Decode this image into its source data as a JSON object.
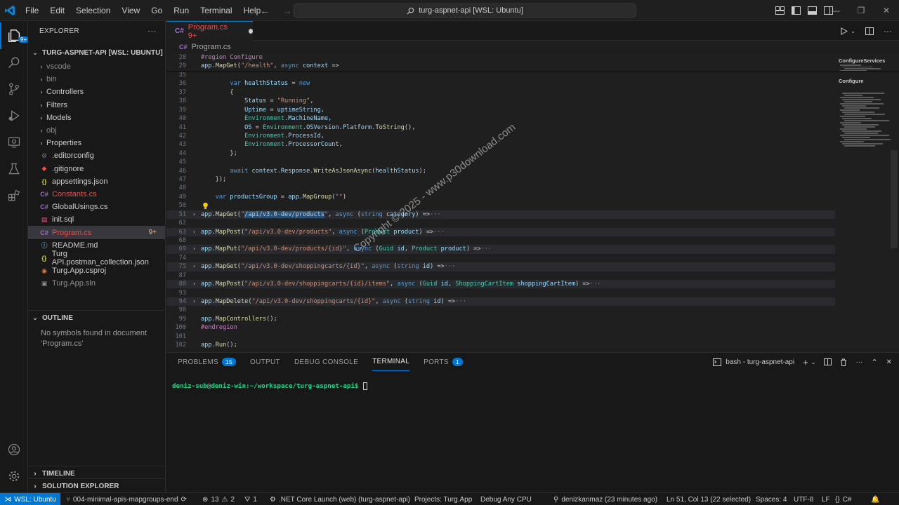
{
  "titlebar": {
    "menu": [
      "File",
      "Edit",
      "Selection",
      "View",
      "Go",
      "Run",
      "Terminal",
      "Help"
    ],
    "search_text": "turg-aspnet-api [WSL: Ubuntu]"
  },
  "sidebar": {
    "explorer_title": "EXPLORER",
    "more": "···",
    "root_label": "TURG-ASPNET-API [WSL: UBUNTU]",
    "items": [
      {
        "label": "vscode",
        "type": "folder",
        "state": "ignored"
      },
      {
        "label": "bin",
        "type": "folder",
        "state": "ignored"
      },
      {
        "label": "Controllers",
        "type": "folder",
        "state": "normal"
      },
      {
        "label": "Filters",
        "type": "folder",
        "state": "normal"
      },
      {
        "label": "Models",
        "type": "folder",
        "state": "normal"
      },
      {
        "label": "obj",
        "type": "folder",
        "state": "ignored"
      },
      {
        "label": "Properties",
        "type": "folder",
        "state": "normal"
      },
      {
        "label": ".editorconfig",
        "type": "file",
        "state": "normal",
        "icon": "gear"
      },
      {
        "label": ".gitignore",
        "type": "file",
        "state": "normal",
        "icon": "git"
      },
      {
        "label": "appsettings.json",
        "type": "file",
        "state": "normal",
        "icon": "json"
      },
      {
        "label": "Constants.cs",
        "type": "file",
        "state": "error",
        "icon": "cs"
      },
      {
        "label": "GlobalUsings.cs",
        "type": "file",
        "state": "normal",
        "icon": "cs"
      },
      {
        "label": "init.sql",
        "type": "file",
        "state": "normal",
        "icon": "db"
      },
      {
        "label": "Program.cs",
        "type": "file",
        "state": "error",
        "icon": "cs",
        "badge": "9+"
      },
      {
        "label": "README.md",
        "type": "file",
        "state": "normal",
        "icon": "info"
      },
      {
        "label": "Turg API.postman_collection.json",
        "type": "file",
        "state": "normal",
        "icon": "json"
      },
      {
        "label": "Turg.App.csproj",
        "type": "file",
        "state": "normal",
        "icon": "rss"
      },
      {
        "label": "Turg.App.sln",
        "type": "file",
        "state": "ignored",
        "icon": "sln"
      }
    ],
    "outline_label": "OUTLINE",
    "outline_empty": "No symbols found in document 'Program.cs'",
    "timeline_label": "TIMELINE",
    "solution_label": "SOLUTION EXPLORER"
  },
  "editor": {
    "tab_label": "Program.cs",
    "tab_badge": "9+",
    "breadcrumb": "Program.cs",
    "sticky": [
      {
        "n": "28",
        "tokens": [
          [
            "pp",
            "#region Configure"
          ]
        ]
      },
      {
        "n": "29",
        "tokens": [
          [
            "id",
            "app"
          ],
          [
            "",
            "."
          ],
          [
            "fn",
            "MapGet"
          ],
          [
            "",
            "("
          ],
          [
            "str",
            "\"/health\""
          ],
          [
            "",
            ", "
          ],
          [
            "kw",
            "async"
          ],
          [
            "",
            " "
          ],
          [
            "id",
            "context"
          ],
          [
            "",
            " =>"
          ]
        ]
      }
    ],
    "lines": [
      {
        "n": "35",
        "tokens": []
      },
      {
        "n": "36",
        "tokens": [
          [
            "",
            "        "
          ],
          [
            "kw",
            "var"
          ],
          [
            "",
            " "
          ],
          [
            "id",
            "healthStatus"
          ],
          [
            "",
            " = "
          ],
          [
            "kw",
            "new"
          ]
        ]
      },
      {
        "n": "37",
        "tokens": [
          [
            "",
            "        {"
          ]
        ]
      },
      {
        "n": "38",
        "tokens": [
          [
            "",
            "            "
          ],
          [
            "id",
            "Status"
          ],
          [
            "",
            " = "
          ],
          [
            "str",
            "\"Running\""
          ],
          [
            "",
            ","
          ]
        ]
      },
      {
        "n": "39",
        "tokens": [
          [
            "",
            "            "
          ],
          [
            "id",
            "Uptime"
          ],
          [
            "",
            " = "
          ],
          [
            "id",
            "uptimeString"
          ],
          [
            "",
            ","
          ]
        ]
      },
      {
        "n": "40",
        "tokens": [
          [
            "",
            "            "
          ],
          [
            "ty",
            "Environment"
          ],
          [
            "",
            "."
          ],
          [
            "id",
            "MachineName"
          ],
          [
            "",
            ","
          ]
        ]
      },
      {
        "n": "41",
        "tokens": [
          [
            "",
            "            "
          ],
          [
            "id",
            "OS"
          ],
          [
            "",
            " = "
          ],
          [
            "ty",
            "Environment"
          ],
          [
            "",
            "."
          ],
          [
            "id",
            "OSVersion"
          ],
          [
            "",
            "."
          ],
          [
            "id",
            "Platform"
          ],
          [
            "",
            "."
          ],
          [
            "fn",
            "ToString"
          ],
          [
            "",
            "(),"
          ]
        ]
      },
      {
        "n": "42",
        "tokens": [
          [
            "",
            "            "
          ],
          [
            "ty",
            "Environment"
          ],
          [
            "",
            "."
          ],
          [
            "id",
            "ProcessId"
          ],
          [
            "",
            ","
          ]
        ]
      },
      {
        "n": "43",
        "tokens": [
          [
            "",
            "            "
          ],
          [
            "ty",
            "Environment"
          ],
          [
            "",
            "."
          ],
          [
            "id",
            "ProcessorCount"
          ],
          [
            "",
            ","
          ]
        ]
      },
      {
        "n": "44",
        "tokens": [
          [
            "",
            "        };"
          ]
        ]
      },
      {
        "n": "45",
        "tokens": []
      },
      {
        "n": "46",
        "tokens": [
          [
            "",
            "        "
          ],
          [
            "kw",
            "await"
          ],
          [
            "",
            " "
          ],
          [
            "id",
            "context"
          ],
          [
            "",
            "."
          ],
          [
            "id",
            "Response"
          ],
          [
            "",
            "."
          ],
          [
            "fn",
            "WriteAsJsonAsync"
          ],
          [
            "",
            "("
          ],
          [
            "id",
            "healthStatus"
          ],
          [
            "",
            ");"
          ]
        ]
      },
      {
        "n": "47",
        "tokens": [
          [
            "",
            "    });"
          ]
        ]
      },
      {
        "n": "48",
        "tokens": []
      },
      {
        "n": "49",
        "tokens": [
          [
            "",
            "    "
          ],
          [
            "kw",
            "var"
          ],
          [
            "",
            " "
          ],
          [
            "id",
            "productsGroup"
          ],
          [
            "",
            " = "
          ],
          [
            "id",
            "app"
          ],
          [
            "",
            "."
          ],
          [
            "fn",
            "MapGroup"
          ],
          [
            "",
            "("
          ],
          [
            "str",
            "\"\""
          ],
          [
            "",
            ")"
          ]
        ]
      },
      {
        "n": "50",
        "tokens": []
      },
      {
        "n": "51",
        "folded": true,
        "tokens": [
          [
            "id",
            "app"
          ],
          [
            "",
            "."
          ],
          [
            "fn",
            "MapGet"
          ],
          [
            "",
            "("
          ],
          [
            "str",
            "\""
          ],
          [
            "selstr",
            "/api/v3.0-dev/products"
          ],
          [
            "str",
            "\""
          ],
          [
            "",
            ", "
          ],
          [
            "kw",
            "async"
          ],
          [
            "",
            " ("
          ],
          [
            "kw",
            "string"
          ],
          [
            "",
            " "
          ],
          [
            "id",
            "category"
          ],
          [
            "",
            ") =>"
          ],
          [
            "ell",
            "···"
          ]
        ]
      },
      {
        "n": "62",
        "tokens": []
      },
      {
        "n": "63",
        "folded": true,
        "tokens": [
          [
            "id",
            "app"
          ],
          [
            "",
            "."
          ],
          [
            "fn",
            "MapPost"
          ],
          [
            "",
            "("
          ],
          [
            "str",
            "\"/api/v3.0-dev/products\""
          ],
          [
            "",
            ", "
          ],
          [
            "kw",
            "async"
          ],
          [
            "",
            " ("
          ],
          [
            "ty",
            "Product"
          ],
          [
            "",
            " "
          ],
          [
            "id",
            "product"
          ],
          [
            "",
            ") =>"
          ],
          [
            "ell",
            "···"
          ]
        ]
      },
      {
        "n": "68",
        "tokens": []
      },
      {
        "n": "69",
        "folded": true,
        "tokens": [
          [
            "id",
            "app"
          ],
          [
            "",
            "."
          ],
          [
            "fn",
            "MapPut"
          ],
          [
            "",
            "("
          ],
          [
            "str",
            "\"/api/v3.0-dev/products/{id}\""
          ],
          [
            "",
            ", "
          ],
          [
            "kw",
            "async"
          ],
          [
            "",
            " ("
          ],
          [
            "ty",
            "Guid"
          ],
          [
            "",
            " "
          ],
          [
            "id",
            "id"
          ],
          [
            "",
            ", "
          ],
          [
            "ty",
            "Product"
          ],
          [
            "",
            " "
          ],
          [
            "id",
            "product"
          ],
          [
            "",
            ") =>"
          ],
          [
            "ell",
            "···"
          ]
        ]
      },
      {
        "n": "74",
        "tokens": []
      },
      {
        "n": "75",
        "folded": true,
        "tokens": [
          [
            "id",
            "app"
          ],
          [
            "",
            "."
          ],
          [
            "fn",
            "MapGet"
          ],
          [
            "",
            "("
          ],
          [
            "str",
            "\"/api/v3.0-dev/shoppingcarts/{id}\""
          ],
          [
            "",
            ", "
          ],
          [
            "kw",
            "async"
          ],
          [
            "",
            " ("
          ],
          [
            "kw",
            "string"
          ],
          [
            "",
            " "
          ],
          [
            "id",
            "id"
          ],
          [
            "",
            ") =>"
          ],
          [
            "ell",
            "···"
          ]
        ]
      },
      {
        "n": "87",
        "tokens": []
      },
      {
        "n": "88",
        "folded": true,
        "tokens": [
          [
            "id",
            "app"
          ],
          [
            "",
            "."
          ],
          [
            "fn",
            "MapPost"
          ],
          [
            "",
            "("
          ],
          [
            "str",
            "\"/api/v3.0-dev/shoppingcarts/{id}/items\""
          ],
          [
            "",
            ", "
          ],
          [
            "kw",
            "async"
          ],
          [
            "",
            " ("
          ],
          [
            "ty",
            "Guid"
          ],
          [
            "",
            " "
          ],
          [
            "id",
            "id"
          ],
          [
            "",
            ", "
          ],
          [
            "ty",
            "ShoppingCartItem"
          ],
          [
            "",
            " "
          ],
          [
            "id",
            "shoppingCartItem"
          ],
          [
            "",
            ") =>"
          ],
          [
            "ell",
            "···"
          ]
        ]
      },
      {
        "n": "93",
        "tokens": []
      },
      {
        "n": "94",
        "folded": true,
        "tokens": [
          [
            "id",
            "app"
          ],
          [
            "",
            "."
          ],
          [
            "fn",
            "MapDelete"
          ],
          [
            "",
            "("
          ],
          [
            "str",
            "\"/api/v3.0-dev/shoppingcarts/{id}\""
          ],
          [
            "",
            ", "
          ],
          [
            "kw",
            "async"
          ],
          [
            "",
            " ("
          ],
          [
            "kw",
            "string"
          ],
          [
            "",
            " "
          ],
          [
            "id",
            "id"
          ],
          [
            "",
            ") =>"
          ],
          [
            "ell",
            "···"
          ]
        ]
      },
      {
        "n": "98",
        "tokens": []
      },
      {
        "n": "99",
        "tokens": [
          [
            "id",
            "app"
          ],
          [
            "",
            "."
          ],
          [
            "fn",
            "MapControllers"
          ],
          [
            "",
            "();"
          ]
        ]
      },
      {
        "n": "100",
        "tokens": [
          [
            "pp",
            "#endregion"
          ]
        ]
      },
      {
        "n": "101",
        "tokens": []
      },
      {
        "n": "102",
        "tokens": [
          [
            "id",
            "app"
          ],
          [
            "",
            "."
          ],
          [
            "fn",
            "Run"
          ],
          [
            "",
            "();"
          ]
        ]
      }
    ],
    "minimap_titles": [
      "ConfigureServices",
      "Configure"
    ]
  },
  "watermark": "Copyright © 2025 - www.p30download.com",
  "panel": {
    "tabs": [
      {
        "label": "PROBLEMS",
        "badge": "15",
        "active": false
      },
      {
        "label": "OUTPUT",
        "badge": "",
        "active": false
      },
      {
        "label": "DEBUG CONSOLE",
        "badge": "",
        "active": false
      },
      {
        "label": "TERMINAL",
        "badge": "",
        "active": true
      },
      {
        "label": "PORTS",
        "badge": "1",
        "active": false
      }
    ],
    "terminal_name": "bash - turg-aspnet-api",
    "prompt": "deniz-sub@deniz-win:~/workspace/turg-aspnet-api$"
  },
  "statusbar": {
    "remote": "WSL: Ubuntu",
    "branch": "004-minimal-apis-mapgroups-end",
    "errors": "13",
    "warnings": "2",
    "ports": "1",
    "launch": ".NET Core Launch (web) (turg-aspnet-api)",
    "projects": "Projects: Turg.App",
    "config": "Debug Any CPU",
    "blame": "denizkanmaz (23 minutes ago)",
    "position": "Ln 51, Col 13 (22 selected)",
    "spaces": "Spaces: 4",
    "encoding": "UTF-8",
    "eol": "LF",
    "language": "C#"
  },
  "colors": {
    "accent": "#0078d4",
    "error": "#f14c4c",
    "modified": "#e2c08d",
    "terminal_prompt": "#23d18b"
  }
}
